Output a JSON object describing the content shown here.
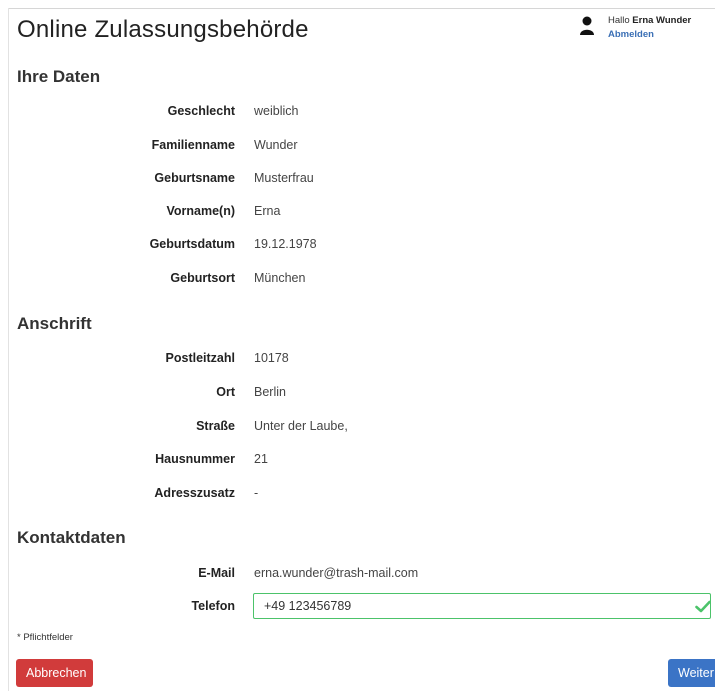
{
  "header": {
    "title": "Online Zulassungsbehörde",
    "greeting": "Hallo",
    "user_name": "Erna Wunder",
    "logout_label": "Abmelden",
    "user_icon": "person-icon"
  },
  "personal": {
    "heading": "Ihre Daten",
    "fields": [
      {
        "label": "Geschlecht",
        "value": "weiblich"
      },
      {
        "label": "Familienname",
        "value": "Wunder"
      },
      {
        "label": "Geburtsname",
        "value": "Musterfrau"
      },
      {
        "label": "Vorname(n)",
        "value": "Erna"
      },
      {
        "label": "Geburtsdatum",
        "value": "19.12.1978"
      },
      {
        "label": "Geburtsort",
        "value": "München"
      }
    ]
  },
  "address": {
    "heading": "Anschrift",
    "fields": [
      {
        "label": "Postleitzahl",
        "value": "10178"
      },
      {
        "label": "Ort",
        "value": "Berlin"
      },
      {
        "label": "Straße",
        "value": "Unter der Laube,"
      },
      {
        "label": "Hausnummer",
        "value": "21"
      },
      {
        "label": "Adresszusatz",
        "value": "-"
      }
    ]
  },
  "contact": {
    "heading": "Kontaktdaten",
    "email_label": "E-Mail",
    "email_value": "erna.wunder@trash-mail.com",
    "phone_label": "Telefon",
    "phone_value": "+49 123456789",
    "phone_valid_icon": "check-icon"
  },
  "required_note": "* Pflichtfelder",
  "actions": {
    "cancel_label": "Abbrechen",
    "next_label": "Weiter"
  },
  "colors": {
    "cancel": "#d13b3b",
    "next": "#3b74c6",
    "valid": "#4cc36a",
    "link": "#3a6fb5"
  }
}
